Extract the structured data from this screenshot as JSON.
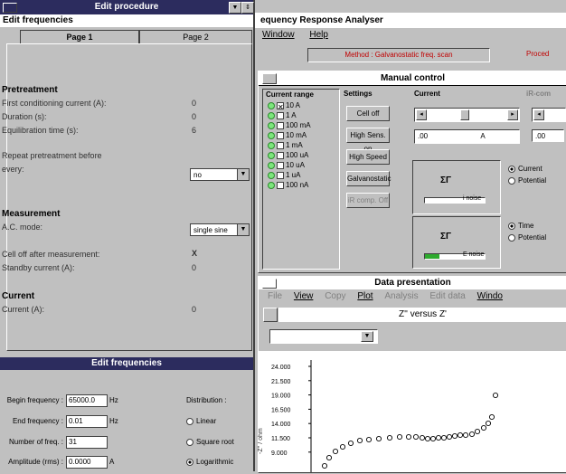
{
  "bg_app": {
    "title": "equency Response Analyser",
    "menu": [
      "Window",
      "Help"
    ],
    "method": "Method : Galvanostatic freq. scan",
    "procedure": "Proced"
  },
  "manual_control": {
    "title": "Manual control",
    "current_range_header": "Current range",
    "settings_header": "Settings",
    "current_header": "Current",
    "ir_header": "iR-com",
    "ranges": [
      "10 A",
      "1 A",
      "100 mA",
      "10 mA",
      "1 mA",
      "100 uA",
      "10 uA",
      "1 uA",
      "100 nA"
    ],
    "buttons": [
      "Cell off",
      "High Sens. on",
      "High Speed",
      "Galvanostatic",
      "iR comp. Off"
    ],
    "current_value": ".00",
    "current_unit": "A",
    "ir_value": ".00",
    "noise1": "i noise",
    "noise2": "E noise",
    "opt1a": "Current",
    "opt1b": "Potential",
    "opt2a": "Time",
    "opt2b": "Potential"
  },
  "data_presentation": {
    "title": "Data presentation",
    "menu": [
      "File",
      "View",
      "Copy",
      "Plot",
      "Analysis",
      "Edit data",
      "Windo"
    ],
    "plot_title": "Z'' versus Z'",
    "y_axis_label": "-Z'' / ohm",
    "y_ticks": [
      "24.000",
      "21.500",
      "19.000",
      "16.500",
      "14.000",
      "11.500",
      "9.000"
    ]
  },
  "edit_procedure": {
    "title": "Edit procedure",
    "subtitle": "Edit frequencies",
    "tab1": "Page 1",
    "tab2": "Page 2",
    "pretreatment_header": "Pretreatment",
    "first_current_label": "First conditioning current (A):",
    "first_current_value": "0",
    "duration_label": "Duration (s):",
    "duration_value": "0",
    "equil_label": "Equilibration time (s):",
    "equil_value": "6",
    "repeat_label1": "Repeat pretreatment before",
    "repeat_label2": "every:",
    "repeat_value": "no",
    "measurement_header": "Measurement",
    "ac_mode_label": "A.C. mode:",
    "ac_mode_value": "single sine",
    "cell_off_label": "Cell off after measurement:",
    "cell_off_value": "X",
    "standby_label": "Standby current (A):",
    "standby_value": "0",
    "current_header": "Current",
    "current_label": "Current (A):",
    "current_value": "0"
  },
  "edit_frequencies": {
    "title": "Edit frequencies",
    "begin_label": "Begin frequency :",
    "begin_value": "65000.0",
    "begin_unit": "Hz",
    "end_label": "End frequency :",
    "end_value": "0.01",
    "end_unit": "Hz",
    "num_label": "Number of freq. :",
    "num_value": "31",
    "amp_label": "Amplitude (rms) :",
    "amp_value": "0.0000",
    "amp_unit": "A",
    "distribution_label": "Distribution :",
    "dist_linear": "Linear",
    "dist_sqrt": "Square root",
    "dist_log": "Logarithmic"
  }
}
